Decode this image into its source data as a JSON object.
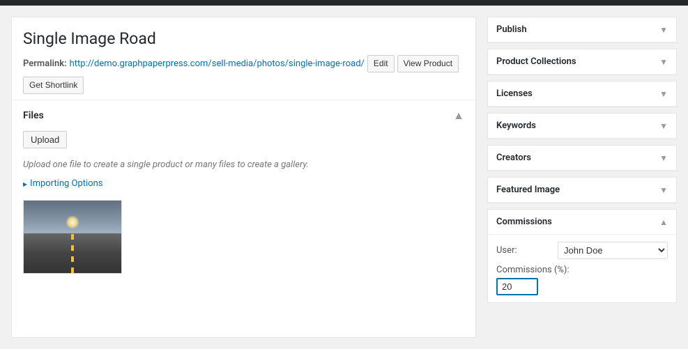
{
  "page": {
    "title": "Single Image Road",
    "permalink": {
      "label": "Permalink:",
      "base_url": "http://demo.graphpaperpress.com/sell-media/photos/",
      "slug": "single-image-road/",
      "edit_button": "Edit",
      "view_button": "View Product"
    },
    "shortlink_button": "Get Shortlink"
  },
  "files_section": {
    "title": "Files",
    "upload_button": "Upload",
    "hint": "Upload one file to create a single product or many files to create a gallery.",
    "importing_options_label": "Importing Options",
    "importing_bullet": "▸"
  },
  "sidebar": {
    "publish": {
      "title": "Publish"
    },
    "product_collections": {
      "title": "Product Collections"
    },
    "licenses": {
      "title": "Licenses"
    },
    "keywords": {
      "title": "Keywords"
    },
    "creators": {
      "title": "Creators"
    },
    "featured_image": {
      "title": "Featured Image"
    },
    "commissions": {
      "title": "Commissions",
      "user_label": "User:",
      "user_value": "John Doe",
      "commissions_label": "Commissions (%):",
      "commissions_value": "20"
    }
  }
}
